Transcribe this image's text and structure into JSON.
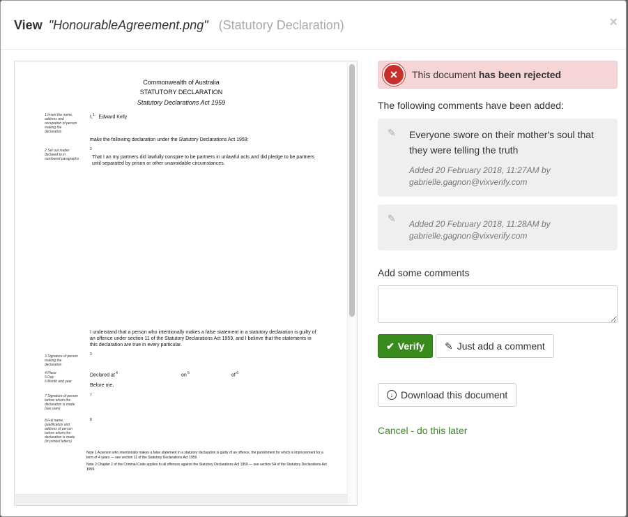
{
  "header": {
    "view_label": "View",
    "file_name": "\"HonourableAgreement.png\"",
    "doc_type": "(Statutory Declaration)",
    "close_glyph": "×"
  },
  "document": {
    "heading_1": "Commonwealth of Australia",
    "heading_2": "STATUTORY DECLARATION",
    "heading_3": "Statutory Declarations Act 1959",
    "margin_1": "Insert the name, address and occupation of person making the declaration",
    "margin_2": "Set out matter declared to in numbered paragraphs",
    "margin_3": "Signature of person making the declaration",
    "margin_4": "Place",
    "margin_5": "Day",
    "margin_6": "Month and year",
    "margin_7": "Signature of person before whom the declaration is made (see over)",
    "margin_8": "Full name, qualification and address of person before whom the declaration is made (in printed letters)",
    "line_i": "I,",
    "name": "Edward Kelly",
    "make_decl": "make the following declaration under the Statutory Declarations Act 1959:",
    "declaration": "That I an my partners did lawfully conspire to be partners in unlawful acts and did pledge to be partners until separated by prison or other unavoidable circumstances.",
    "understand": "I understand that a person who intentionally makes a false statement in a statutory declaration is guilty of an offence under section 11 of the Statutory Declarations Act 1959, and I believe that the statements in this declaration are true in every particular.",
    "declared_at": "Declared at",
    "on": "on",
    "of": "of",
    "before_me": "Before me,",
    "note_1": "Note 1  A person who intentionally makes a false statement in a statutory declaration is guilty of an offence, the punishment for which is imprisonment for a term of 4 years — see section 11 of the Statutory Declarations Act 1959.",
    "note_2": "Note 2  Chapter 2 of the Criminal Code applies to all offences against the Statutory Declarations Act 1959 — see section 5A of the Statutory Declarations Act 1959."
  },
  "status": {
    "prefix": "This document",
    "strong": "has been rejected",
    "icon": "rejected-x-icon"
  },
  "comments_lead": "The following comments have been added:",
  "comments": [
    {
      "text": "Everyone swore on their mother's soul that they were telling the truth",
      "meta": "Added 20 February 2018, 11:27AM by gabrielle.gagnon@vixverify.com"
    },
    {
      "text": "",
      "meta": "Added 20 February 2018, 11:28AM by gabrielle.gagnon@vixverify.com"
    }
  ],
  "add_comments_label": "Add some comments",
  "textarea_value": "",
  "buttons": {
    "verify": "Verify",
    "just_comment": "Just add a comment",
    "download": "Download this document",
    "cancel": "Cancel - do this later"
  },
  "colors": {
    "verify_green": "#398b1e",
    "alert_bg": "#f6d5d6",
    "reject_red": "#c9302c"
  }
}
